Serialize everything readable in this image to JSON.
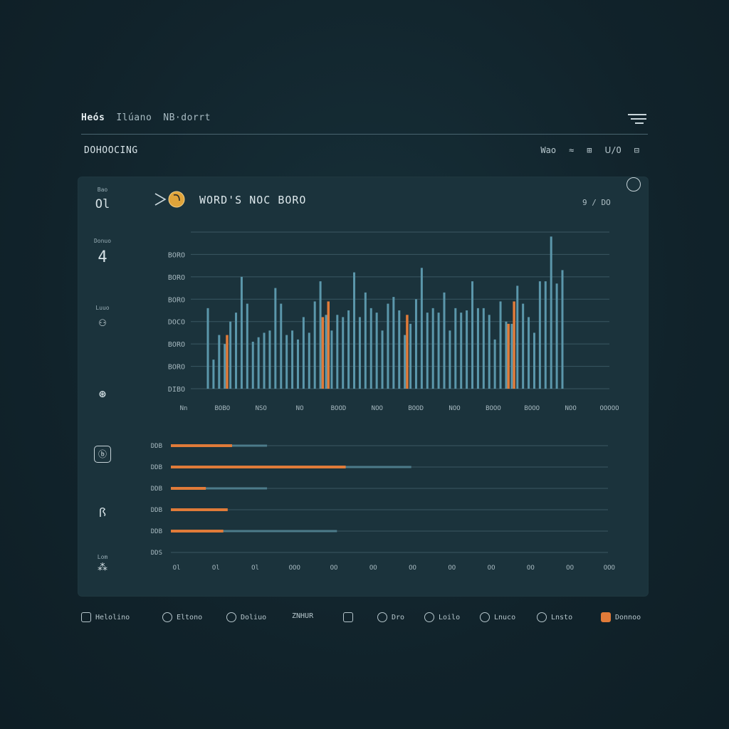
{
  "topnav": [
    "Heós",
    "Ilúano",
    "NB·dorrt"
  ],
  "page_title": "DOHOOCING",
  "actions": [
    "Wao",
    "≈",
    "⊞",
    "ᑌ/O",
    "⊟"
  ],
  "sidebar": [
    {
      "label": "Bao",
      "glyph": "Ol",
      "icon": "text-icon"
    },
    {
      "label": "Donuo",
      "glyph": "4",
      "icon": "number-icon"
    },
    {
      "label": "Luuo",
      "glyph": "⚇",
      "icon": "users-icon"
    },
    {
      "label": "",
      "glyph": "⊛",
      "icon": "settings-icon"
    },
    {
      "label": "",
      "glyph": "ⓑ",
      "icon": "box-icon"
    },
    {
      "label": "",
      "glyph": "ꟗ",
      "icon": "grid-icon"
    },
    {
      "label": "Lom",
      "glyph": "⁂",
      "icon": "star-icon"
    }
  ],
  "chart_header": {
    "title": "WORD'S NOC BORO",
    "page": "9 / DO"
  },
  "chart_data": [
    {
      "type": "bar",
      "ytick_labels": [
        "BORO",
        "BORO",
        "BORO",
        "DOCO",
        "BORO",
        "BORO",
        "DIBO"
      ],
      "xtick_labels": [
        "Nn",
        "BOBO",
        "NSO",
        "NO",
        "BOOD",
        "NOO",
        "BOOD",
        "NOO",
        "BOOO",
        "BOOO",
        "NOO",
        "OOOOO"
      ],
      "ylim": [
        0,
        7
      ],
      "colors": {
        "blue": "#5b97ab",
        "orange": "#e07b39"
      },
      "series": [
        {
          "values": [
            3.6,
            1.3,
            2.4,
            2.0,
            3.0,
            3.4,
            5.0,
            3.8,
            2.1,
            2.3,
            2.5,
            2.6,
            4.5,
            3.8,
            2.4,
            2.6,
            2.2,
            3.2,
            2.5,
            3.9,
            4.8,
            3.3,
            2.6,
            3.3,
            3.2,
            3.5,
            5.2,
            3.2,
            4.3,
            3.6,
            3.4,
            2.6,
            3.8,
            4.1,
            3.5,
            2.4,
            2.9,
            4.0,
            5.4,
            3.4,
            3.6,
            3.4,
            4.3,
            2.6,
            3.6,
            3.4,
            3.5,
            4.8,
            3.6,
            3.6,
            3.3,
            2.2,
            3.9,
            3.0,
            2.9,
            4.6,
            3.8,
            3.2,
            2.5,
            4.8,
            4.8,
            6.8,
            4.7,
            5.3
          ]
        },
        {
          "values": [
            0,
            0,
            0,
            2.4,
            0,
            0,
            0,
            0,
            0,
            0,
            0,
            0,
            0,
            0,
            0,
            0,
            0,
            0,
            0,
            0,
            3.2,
            3.9,
            0,
            0,
            0,
            0,
            0,
            0,
            0,
            0,
            0,
            0,
            0,
            0,
            0,
            3.3,
            0,
            0,
            0,
            0,
            0,
            0,
            0,
            0,
            0,
            0,
            0,
            0,
            0,
            0,
            0,
            0,
            0,
            2.9,
            3.9,
            0,
            0,
            0,
            0,
            0,
            0,
            0,
            0,
            0
          ]
        }
      ]
    },
    {
      "type": "bar",
      "orientation": "horizontal",
      "ytick_labels": [
        "DDB",
        "DDB",
        "DDB",
        "DDB",
        "DDB",
        "DDS"
      ],
      "xtick_labels": [
        "Ol",
        "Ol",
        "Ol",
        "OOO",
        "OO",
        "OO",
        "OO",
        "OO",
        "OO",
        "OO",
        "OO",
        "OOO"
      ],
      "xlim": [
        0,
        100
      ],
      "series": [
        {
          "values": [
            14,
            40,
            8,
            13,
            12,
            0
          ]
        },
        {
          "values": [
            22,
            55,
            22,
            0,
            38,
            0
          ]
        }
      ]
    }
  ],
  "bottom_nav": [
    {
      "label": "Helolino",
      "icon": "home-icon"
    },
    {
      "label": "Eltono",
      "icon": "car-icon"
    },
    {
      "label": "Doliuo",
      "icon": "chat-icon"
    },
    {
      "label": "ZNHUR",
      "icon": "pen-icon"
    },
    {
      "label": "",
      "icon": "plus-icon"
    },
    {
      "label": "Dro",
      "icon": "globe-icon"
    },
    {
      "label": "Loilo",
      "icon": "clock-icon"
    },
    {
      "label": "Lnuco",
      "icon": "compass-icon"
    },
    {
      "label": "Lnsto",
      "icon": "target-icon"
    },
    {
      "label": "Donnoo",
      "icon": "folder-icon",
      "active": true
    }
  ]
}
